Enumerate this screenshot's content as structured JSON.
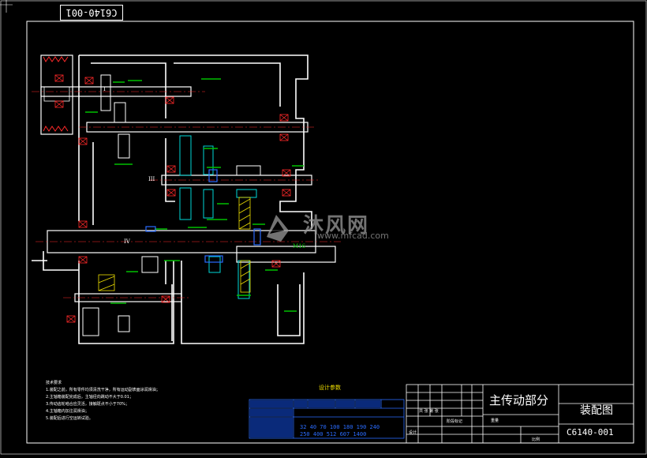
{
  "drawing": {
    "sheet_code": "C6140-001",
    "title": "主传动部分",
    "kind": "装配图",
    "code": "C6140-001"
  },
  "title_block": {
    "cells": [
      "标记",
      "处数",
      "分区",
      "更改文件号",
      "签名",
      "年月日"
    ],
    "rows": [
      "设计",
      "审核",
      "工艺",
      "批准"
    ],
    "stage_label": "阶段标记",
    "weight_label": "重量",
    "scale_label": "比例",
    "sheet_label": "共 张 第 张"
  },
  "params": {
    "title": "设计参数",
    "speeds_line1": "32 40 70 100 180 190 240",
    "speeds_line2": "250 400 512 607 1400"
  },
  "notes": {
    "heading": "技术要求",
    "items": [
      "1.装配之前，所有零件均须清洗干净，所有运动副表面涂润滑油；",
      "2.主轴箱装配完成后，主轴径向跳动不大于0.01；",
      "3.传动齿轮啮合应灵活，接触斑点不小于70%；",
      "4.主轴箱内加注润滑油；",
      "5.装配后进行空运转试验。"
    ]
  },
  "shaft_labels": {
    "i": "I",
    "iii": "III",
    "iv": "IV",
    "m": "M16"
  },
  "watermark": {
    "text": "沐风网",
    "url": "www.mfcad.com"
  },
  "colors": {
    "background": "#000000",
    "outline": "#ffffff",
    "gear": "#00d8d8",
    "bearing": "#ff2a2a",
    "dimension": "#00c000",
    "table": "#2a6cff",
    "note": "#f0e000"
  }
}
